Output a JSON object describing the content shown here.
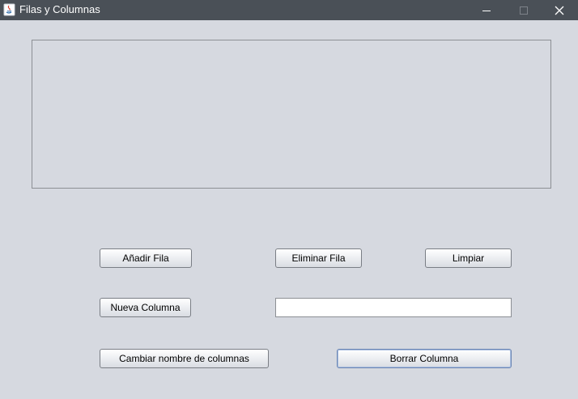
{
  "window": {
    "title": "Filas y Columnas",
    "controls": {
      "minimize": "minimize-icon",
      "maximize": "maximize-icon",
      "close": "close-icon"
    }
  },
  "table": {
    "rows": [],
    "columns": []
  },
  "buttons": {
    "add_row": "Añadir Fila",
    "delete_row": "Eliminar Fila",
    "clear": "Limpiar",
    "new_column": "Nueva Columna",
    "rename_columns": "Cambiar nombre de columnas",
    "delete_column": "Borrar Columna"
  },
  "column_name_field": {
    "value": "",
    "placeholder": ""
  },
  "colors": {
    "titlebar": "#4a5057",
    "background": "#d6d9e0",
    "focus_border": "#6b86b3"
  }
}
